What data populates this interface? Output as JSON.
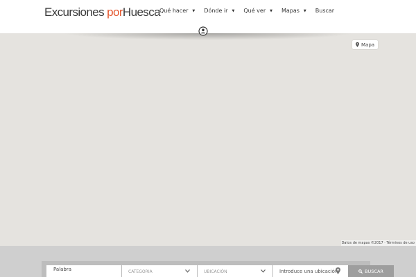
{
  "header": {
    "logo": {
      "part1": "Excursiones",
      "part2": "por",
      "part3": "Huesca"
    },
    "nav": [
      {
        "label": "Qué hacer",
        "has_dropdown": true
      },
      {
        "label": "Dónde ir",
        "has_dropdown": true
      },
      {
        "label": "Qué ver",
        "has_dropdown": true
      },
      {
        "label": "Mapas",
        "has_dropdown": true
      },
      {
        "label": "Buscar",
        "has_dropdown": false
      }
    ],
    "user_icon": "user-circle-icon"
  },
  "map": {
    "button_label": "Mapa",
    "button_icon": "map-marker-icon",
    "attribution": "Datos de mapas ©2017 · Términos de uso"
  },
  "search": {
    "keyword_placeholder": "Palabra",
    "category_placeholder": "CATEGORIA",
    "location_placeholder": "UBICACIÓN",
    "address_placeholder": "Introduce una ubicación",
    "button_label": "BUSCAR"
  },
  "colors": {
    "brand_accent": "#e4572e",
    "map_bg": "#e5e3df",
    "band_bg": "#cfcfcf"
  }
}
